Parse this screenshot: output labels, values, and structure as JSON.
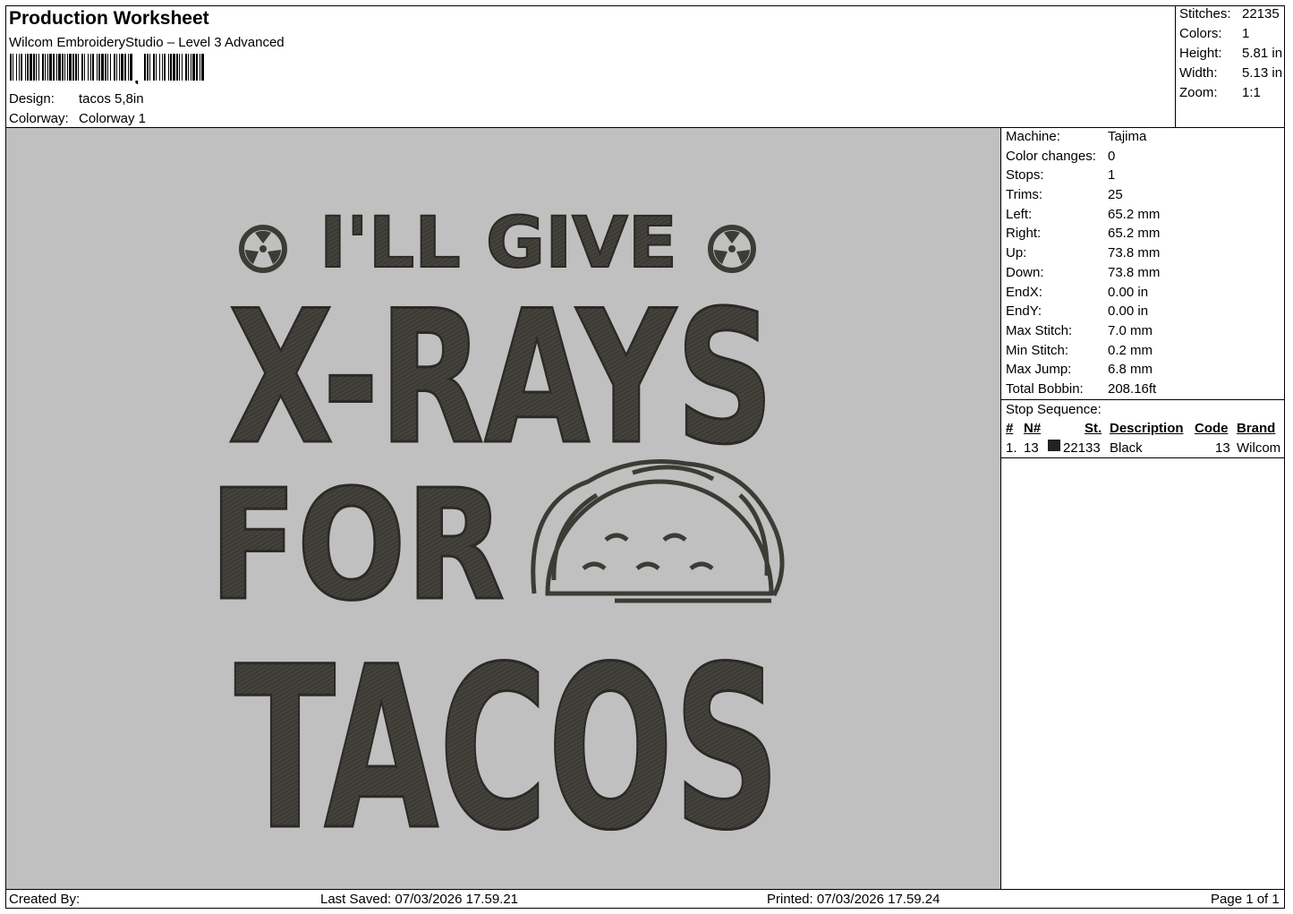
{
  "header": {
    "title": "Production Worksheet",
    "software": "Wilcom EmbroideryStudio – Level 3 Advanced",
    "design_label": "Design:",
    "design_value": "tacos 5,8in",
    "colorway_label": "Colorway:",
    "colorway_value": "Colorway 1"
  },
  "stats": [
    {
      "label": "Stitches:",
      "value": "22135"
    },
    {
      "label": "Colors:",
      "value": "1"
    },
    {
      "label": "Height:",
      "value": "5.81 in"
    },
    {
      "label": "Width:",
      "value": "5.13 in"
    },
    {
      "label": "Zoom:",
      "value": "1:1"
    }
  ],
  "design": {
    "line1": "I'LL GIVE",
    "line2": "X-RAYS",
    "line3": "FOR",
    "line4": "TACOS",
    "thread_color": "#3d3b36",
    "background_color": "#c0c0c0"
  },
  "machine_info": [
    {
      "label": "Machine:",
      "value": "Tajima"
    },
    {
      "label": "Color changes:",
      "value": "0"
    },
    {
      "label": "Stops:",
      "value": "1"
    },
    {
      "label": "Trims:",
      "value": "25"
    },
    {
      "label": "Left:",
      "value": "65.2 mm"
    },
    {
      "label": "Right:",
      "value": "65.2 mm"
    },
    {
      "label": "Up:",
      "value": "73.8 mm"
    },
    {
      "label": "Down:",
      "value": "73.8 mm"
    },
    {
      "label": "EndX:",
      "value": "0.00 in"
    },
    {
      "label": "EndY:",
      "value": "0.00 in"
    },
    {
      "label": "Max Stitch:",
      "value": "7.0 mm"
    },
    {
      "label": "Min Stitch:",
      "value": "0.2 mm"
    },
    {
      "label": "Max Jump:",
      "value": "6.8 mm"
    },
    {
      "label": "Total Bobbin:",
      "value": "208.16ft"
    }
  ],
  "stop_sequence": {
    "title": "Stop Sequence:",
    "columns": [
      "#",
      "N#",
      "St.",
      "Description",
      "Code",
      "Brand"
    ],
    "rows": [
      {
        "index": "1.",
        "n": "13",
        "swatch_color": "#222222",
        "st": "22133",
        "description": "Black",
        "code": "13",
        "brand": "Wilcom"
      }
    ]
  },
  "footer": {
    "created_by": "Created By:",
    "last_saved": "Last Saved: 07/03/2026 17.59.21",
    "printed": "Printed: 07/03/2026 17.59.24",
    "page": "Page 1 of 1"
  }
}
